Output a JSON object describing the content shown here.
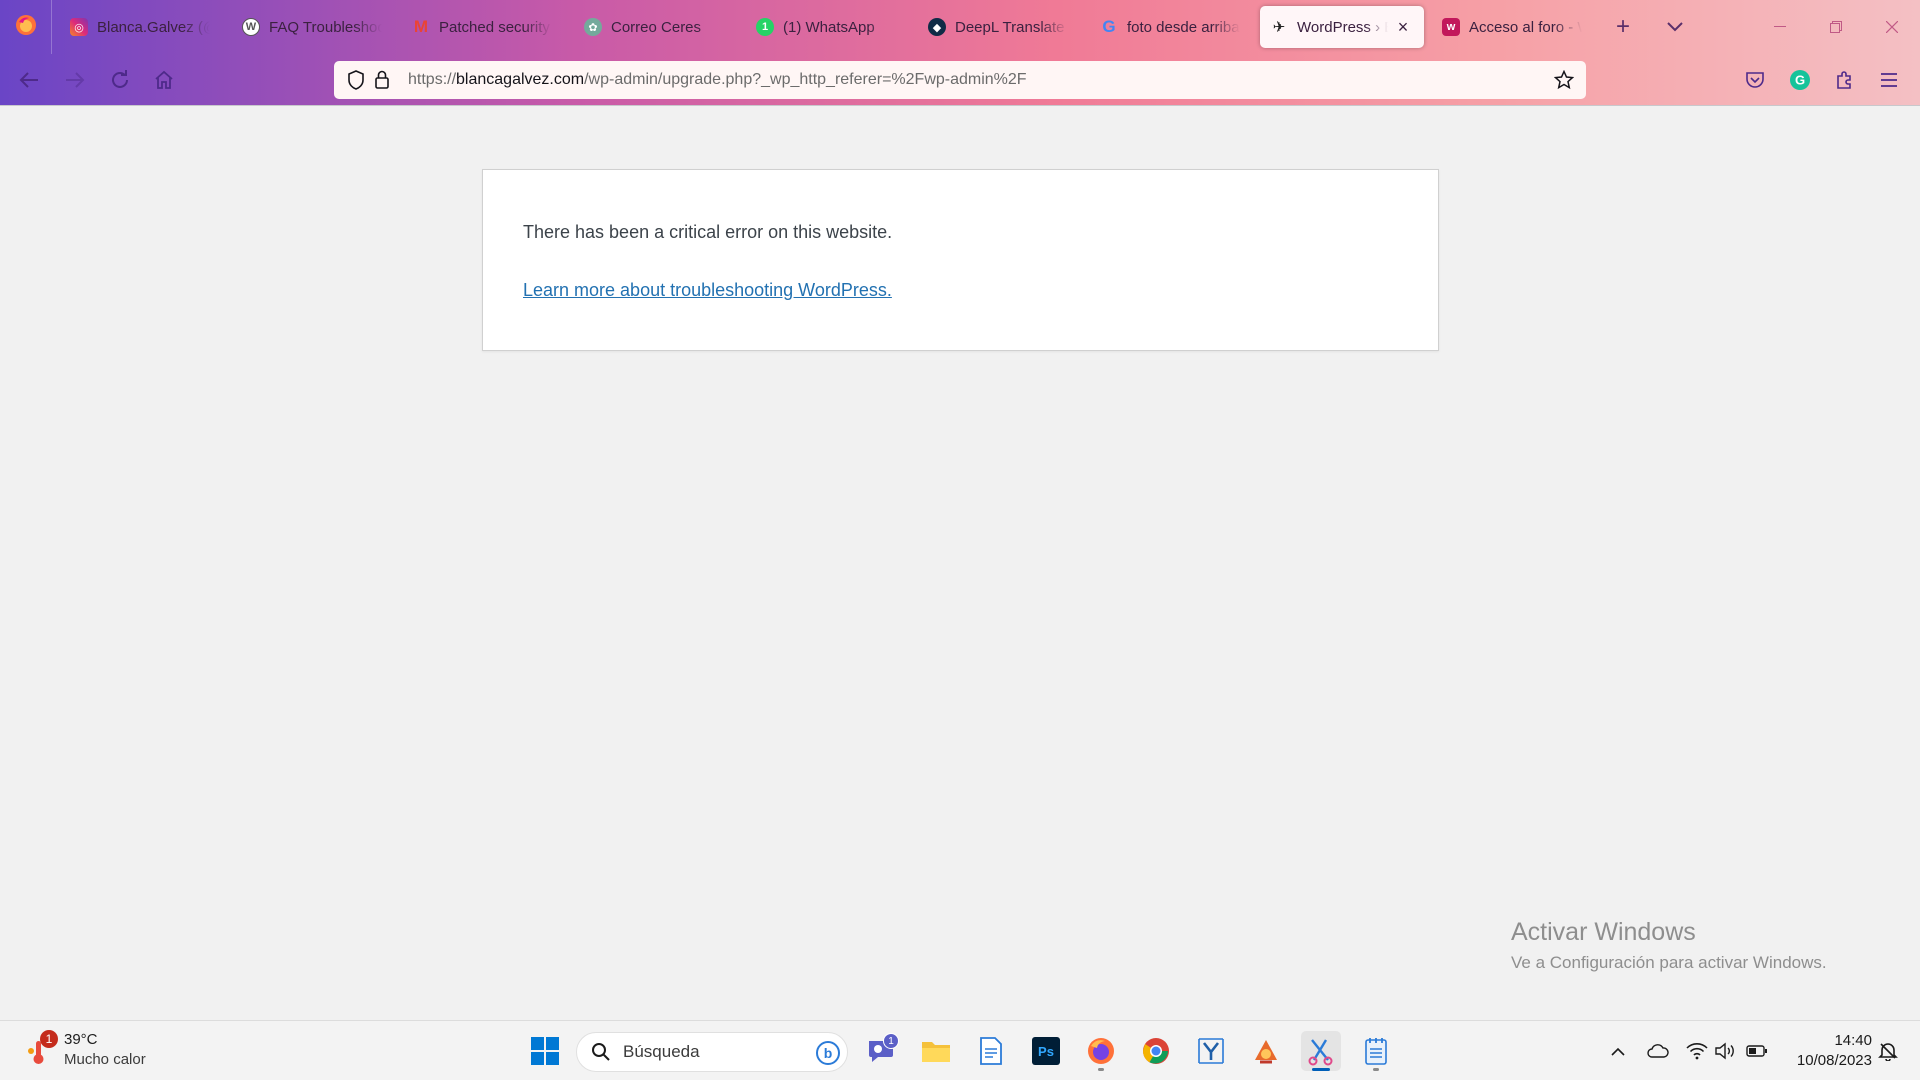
{
  "browser": {
    "tabs": [
      {
        "label": "Blanca.Galvez (@blancagalvez)",
        "icon": "instagram-icon",
        "color": "#e1306c"
      },
      {
        "label": "FAQ Troubleshooting",
        "icon": "wordpress-icon",
        "color": "#555555"
      },
      {
        "label": "Patched security vulnerability",
        "icon": "gmail-icon",
        "color": "#ea4335"
      },
      {
        "label": "Correo Ceres",
        "icon": "ceres-icon",
        "color": "#74aa9c"
      },
      {
        "label": "(1) WhatsApp",
        "icon": "whatsapp-icon",
        "color": "#25d366"
      },
      {
        "label": "DeepL Translate",
        "icon": "deepl-icon",
        "color": "#0f2b46"
      },
      {
        "label": "foto desde arriba",
        "icon": "google-icon",
        "color": "#4285f4"
      },
      {
        "label": "WordPress › Error",
        "icon": "bird-icon",
        "color": "#222222",
        "active": true
      },
      {
        "label": "Acceso al foro - W",
        "icon": "forum-icon",
        "color": "#c2185b"
      }
    ],
    "close_tab": "×",
    "new_tab": "+",
    "list_tabs": "⌄",
    "url": {
      "scheme": "https://",
      "host": "blancagalvez.com",
      "path": "/wp-admin/upgrade.php?_wp_http_referer=%2Fwp-admin%2F"
    }
  },
  "page": {
    "message": "There has been a critical error on this website.",
    "link": "Learn more about troubleshooting WordPress."
  },
  "watermark": {
    "title": "Activar Windows",
    "subtitle": "Ve a Configuración para activar Windows."
  },
  "taskbar": {
    "weather_temp": "39°C",
    "weather_cond": "Mucho calor",
    "weather_badge": "1",
    "search_placeholder": "Búsqueda",
    "teams_badge": "1",
    "time": "14:40",
    "date": "10/08/2023"
  },
  "colors": {
    "link": "#2271b1",
    "accent": "#005fb8"
  }
}
